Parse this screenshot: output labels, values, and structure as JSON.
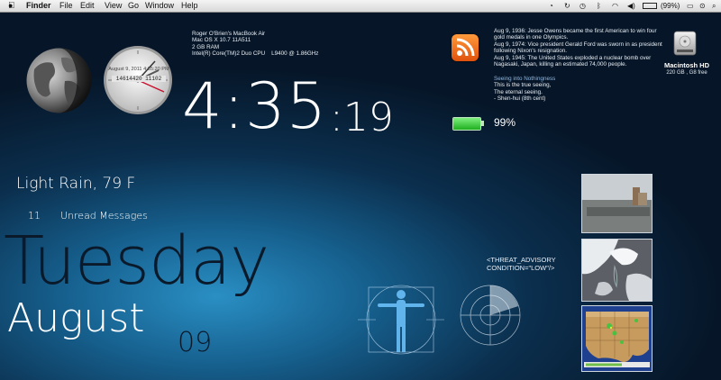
{
  "menubar": {
    "apple_icon": "apple-logo-icon",
    "items": [
      "Finder",
      "File",
      "Edit",
      "View",
      "Go",
      "Window",
      "Help"
    ],
    "battery_percent": "(99%)",
    "status_icons": [
      "clock-icon",
      "sync-icon",
      "bluetooth-icon",
      "wifi-icon",
      "volume-icon",
      "battery-icon",
      "date-icon",
      "user-icon",
      "spotlight-icon"
    ]
  },
  "system_info": {
    "lines": [
      "Roger O'Brien's MacBook Air",
      "Mac OS X 10.7 11A511",
      "2 GB RAM",
      "Intel(R) Core(TM)2 Duo CPU    L9400 @ 1.86GHz"
    ]
  },
  "analog_clock": {
    "date_text": "August 9, 2011 4:35:20 PM",
    "digits": "14614420 11102"
  },
  "time": {
    "hm": "4:35",
    "seconds": ":19"
  },
  "battery": {
    "percent": "99%",
    "level": 0.99,
    "color": "#2ecc2e"
  },
  "rss_icon": "rss-feed-icon",
  "history": {
    "lines": [
      "Aug 9, 1936: Jesse Owens became the first American to win four",
      "gold medals in one Olympics.",
      "Aug 9, 1974: Vice president Gerald Ford was sworn in as president",
      "following Nixon's resignation.",
      "Aug 9, 1945: The United States exploded a nuclear bomb over",
      "Nagasaki, Japan, killing an estimated 74,000 people."
    ]
  },
  "quote": {
    "lines": [
      "Seeing into Nothingness",
      "This is the true seeing,",
      "The eternal seeing.",
      "- Shen-hui (8th cent)"
    ],
    "title_color": "#8fb7e0"
  },
  "drive": {
    "name": "Macintosh HD",
    "info": "220 GB , G8 free",
    "icon": "hard-drive-icon"
  },
  "weather": {
    "text": "Light Rain, 79 F"
  },
  "mail": {
    "count": "11",
    "label": "Unread Messages"
  },
  "date": {
    "weekday": "Tuesday",
    "month": "August",
    "day": "09"
  },
  "threat": {
    "line1": "<THREAT_ADVISORY",
    "line2": "CONDITION=\"LOW\"/>"
  },
  "widgets": {
    "vitruvian": "vitruvian-man-icon",
    "radar": "radar-sweep-icon"
  },
  "weather_images": [
    "webcam-photo",
    "satellite-image",
    "radar-map"
  ]
}
